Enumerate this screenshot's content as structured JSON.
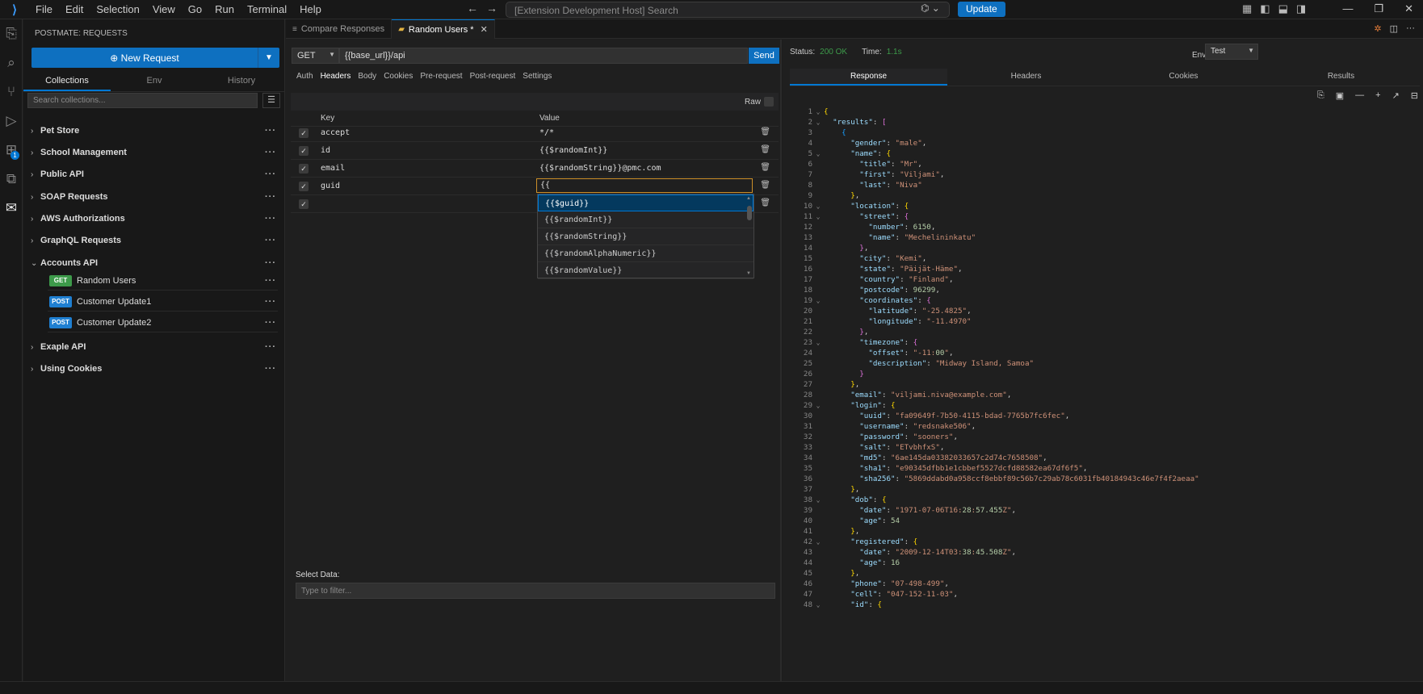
{
  "titlebar": {
    "menu": [
      "File",
      "Edit",
      "Selection",
      "View",
      "Go",
      "Run",
      "Terminal",
      "Help"
    ],
    "search": "[Extension Development Host] Search",
    "update": "Update"
  },
  "sidebar": {
    "title": "POSTMATE: REQUESTS",
    "new_request": "New Request",
    "tabs": [
      "Collections",
      "Env",
      "History"
    ],
    "search_placeholder": "Search collections...",
    "collections": [
      "Pet Store",
      "School Management",
      "Public API",
      "SOAP Requests",
      "AWS Authorizations",
      "GraphQL Requests",
      "Accounts API",
      "Exaple API",
      "Using Cookies"
    ],
    "requests": [
      {
        "method": "GET",
        "name": "Random Users"
      },
      {
        "method": "POST",
        "name": "Customer Update1"
      },
      {
        "method": "POST",
        "name": "Customer Update2"
      }
    ]
  },
  "editor_tabs": [
    {
      "label": "Compare Responses"
    },
    {
      "label": "Random Users *"
    }
  ],
  "request": {
    "method": "GET",
    "url": "{{base_url}}/api",
    "send": "Send",
    "tabs": [
      "Auth",
      "Headers",
      "Body",
      "Cookies",
      "Pre-request",
      "Post-request",
      "Settings"
    ],
    "raw": "Raw",
    "columns": {
      "key": "Key",
      "value": "Value"
    },
    "headers": [
      {
        "key": "accept",
        "value": "*/*"
      },
      {
        "key": "id",
        "value": "{{$randomInt}}"
      },
      {
        "key": "email",
        "value": "{{$randomString}}@pmc.com"
      },
      {
        "key": "guid",
        "value": "{{"
      }
    ],
    "autocomplete": [
      "{{$guid}}",
      "{{$randomInt}}",
      "{{$randomString}}",
      "{{$randomAlphaNumeric}}",
      "{{$randomValue}}"
    ],
    "select_data": "Select Data:",
    "filter_placeholder": "Type to filter..."
  },
  "response": {
    "status_label": "Status:",
    "status_value": "200 OK",
    "time_label": "Time:",
    "time_value": "1.1s",
    "env_label": "Env",
    "env_value": "Test",
    "tabs": [
      "Response",
      "Headers",
      "Cookies",
      "Results"
    ],
    "lines": [
      "{",
      "  \"results\": [",
      "    {",
      "      \"gender\": \"male\",",
      "      \"name\": {",
      "        \"title\": \"Mr\",",
      "        \"first\": \"Viljami\",",
      "        \"last\": \"Niva\"",
      "      },",
      "      \"location\": {",
      "        \"street\": {",
      "          \"number\": 6150,",
      "          \"name\": \"Mechelininkatu\"",
      "        },",
      "        \"city\": \"Kemi\",",
      "        \"state\": \"Päijät-Häme\",",
      "        \"country\": \"Finland\",",
      "        \"postcode\": 96299,",
      "        \"coordinates\": {",
      "          \"latitude\": \"-25.4825\",",
      "          \"longitude\": \"-11.4970\"",
      "        },",
      "        \"timezone\": {",
      "          \"offset\": \"-11:00\",",
      "          \"description\": \"Midway Island, Samoa\"",
      "        }",
      "      },",
      "      \"email\": \"viljami.niva@example.com\",",
      "      \"login\": {",
      "        \"uuid\": \"fa09649f-7b50-4115-bdad-7765b7fc6fec\",",
      "        \"username\": \"redsnake506\",",
      "        \"password\": \"sooners\",",
      "        \"salt\": \"ETvbhfxS\",",
      "        \"md5\": \"6ae145da03382033657c2d74c7658508\",",
      "        \"sha1\": \"e90345dfbb1e1cbbef5527dcfd88582ea67df6f5\",",
      "        \"sha256\": \"5869ddabd0a958ccf8ebbf89c56b7c29ab78c6031fb40184943c46e7f4f2aeaa\"",
      "      },",
      "      \"dob\": {",
      "        \"date\": \"1971-07-06T16:28:57.455Z\",",
      "        \"age\": 54",
      "      },",
      "      \"registered\": {",
      "        \"date\": \"2009-12-14T03:38:45.508Z\",",
      "        \"age\": 16",
      "      },",
      "      \"phone\": \"07-498-499\",",
      "      \"cell\": \"047-152-11-03\",",
      "      \"id\": {"
    ],
    "folds": [
      1,
      2,
      5,
      10,
      11,
      19,
      23,
      29,
      38,
      42,
      48
    ]
  }
}
